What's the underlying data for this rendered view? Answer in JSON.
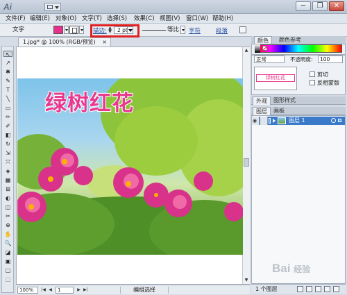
{
  "app": {
    "logo": "Ai",
    "window_buttons": [
      "─",
      "❐",
      "✕"
    ]
  },
  "menu": [
    "文件(F)",
    "编辑(E)",
    "对象(O)",
    "文字(T)",
    "选择(S)",
    "效果(C)",
    "视图(V)",
    "窗口(W)",
    "帮助(H)"
  ],
  "control_bar": {
    "object_label": "文字",
    "fill_color": "#e6318a",
    "stroke_label": "描边:",
    "stroke_value": "2 pt",
    "profile_label": "等比",
    "char_label": "字符",
    "para_label": "段落"
  },
  "document": {
    "tab_title": "1.jpg* @ 100% (RGB/预览)",
    "tab_close": "×",
    "artwork_title": "绿树红花"
  },
  "status_bar": {
    "zoom": "100%",
    "artboard": "1",
    "tool_label": "编组选择",
    "nav_first": "|◀",
    "nav_prev": "◀",
    "nav_next": "▶",
    "nav_last": "▶|"
  },
  "panels": {
    "color_tabs": [
      "颜色",
      "颜色参考"
    ],
    "transparency": {
      "blend_mode": "正常",
      "opacity_label": "不透明度:",
      "opacity_value": "100",
      "thumb_text": "绿树红花",
      "clip_label": "剪切",
      "invert_label": "反相蒙版"
    },
    "appearance_tabs": [
      "外观",
      "图形样式"
    ],
    "layers_tabs": [
      "图层",
      "画板"
    ],
    "layer_name": "图层 1",
    "layer_count": "1 个图层"
  },
  "watermark": {
    "text": "Bai",
    "suffix": "经验"
  },
  "tools": [
    "↖",
    "↗",
    "✱",
    "✎",
    "T",
    "╲",
    "▭",
    "✏",
    "✐",
    "◧",
    "↻",
    "⇲",
    "⤧",
    "◈",
    "▦",
    "⊞",
    "◐",
    "◫",
    "✂",
    "⊕",
    "✋",
    "🔍",
    "◪",
    "▣",
    "▢",
    "⬚"
  ],
  "colors": {
    "accent_pink": "#e8398f",
    "highlight_red": "#e02020",
    "layer_select_blue": "#3b79c9"
  }
}
